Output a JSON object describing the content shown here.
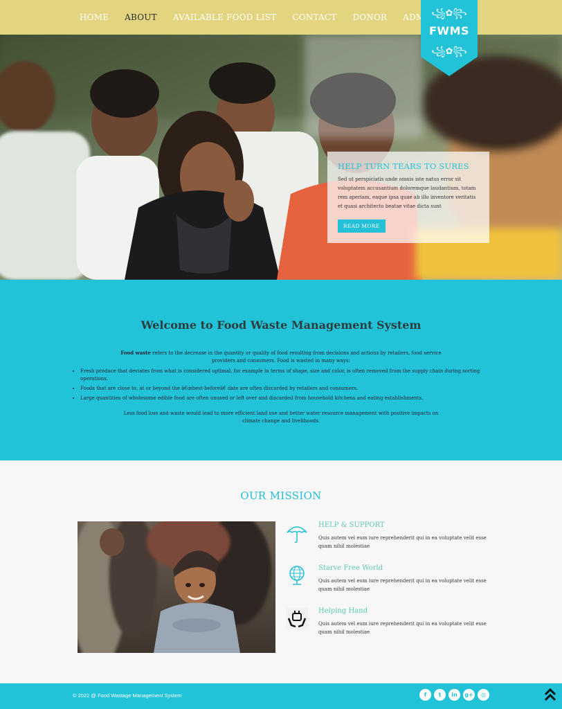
{
  "nav": {
    "items": [
      "HOME",
      "ABOUT",
      "AVAILABLE FOOD LIST",
      "CONTACT",
      "DONOR",
      "ADMIN"
    ],
    "active": "ABOUT",
    "logo_text": "FWMS",
    "ornament": "꧁✿꧂"
  },
  "hero": {
    "heading": "HELP TURN TEARS TO SURES",
    "text": "Sed ut perspiciatis unde omnis iste natus error sit voluptatem accusantium doloremque laudantium, totam rem aperiam, eaque ipsa quae ab illo inventore veritatis et quasi architecto beatae vitae dicta sunt",
    "button": "READ MORE"
  },
  "welcome": {
    "title": "Welcome to Food Waste Management System",
    "intro_bold": "Food waste",
    "intro_rest": " refers to the decrease in the quantity or quality of food resulting from decisions and actions by retailers, food service providers and consumers.  Food is wasted in many ways:",
    "bullets": [
      "Fresh produce that deviates from what is considered optimal, for example in terms of shape, size and color, is often removed from the supply chain during sorting operations.",
      "Foods that are close to, at or beyond the â€œbest-beforeâ€ date are often discarded by retailers and consumers.",
      "Large quantities of wholesome edible food are often unused or left over and discarded from household kitchens and eating establishments."
    ],
    "outro": "Less food loss and waste would lead to more efficient land use and better water resource management with positive impacts on climate change and livelihoods."
  },
  "mission": {
    "title": "OUR MISSION",
    "features": [
      {
        "icon": "umbrella-icon",
        "title": "HELP & SUPPORT",
        "text": "Quis autem vel eum iure reprehenderit qui in ea voluptate velit esse quam nihil molestiae"
      },
      {
        "icon": "globe-icon",
        "title": "Starve Free World",
        "text": "Quis autem vel eum iure reprehenderit qui in ea voluptate velit esse quam nihil molestiae"
      },
      {
        "icon": "helping-hand-icon",
        "title": "Helping Hand",
        "text": "Quis autem vel eum iure reprehenderit qui in ea voluptate velit esse quam nihil molestiae"
      }
    ]
  },
  "footer": {
    "copyright": "© 2022 @ Food Wastage Management System",
    "socials": [
      {
        "name": "facebook-icon",
        "glyph": "f"
      },
      {
        "name": "twitter-icon",
        "glyph": "t"
      },
      {
        "name": "linkedin-icon",
        "glyph": "in"
      },
      {
        "name": "google-plus-icon",
        "glyph": "g+"
      },
      {
        "name": "dribbble-icon",
        "glyph": "◎"
      }
    ]
  },
  "colors": {
    "nav_bg": "#e3d57f",
    "accent": "#22c2d9",
    "feature_title": "#5dc7b3",
    "text_dark": "#2c3d3f"
  }
}
